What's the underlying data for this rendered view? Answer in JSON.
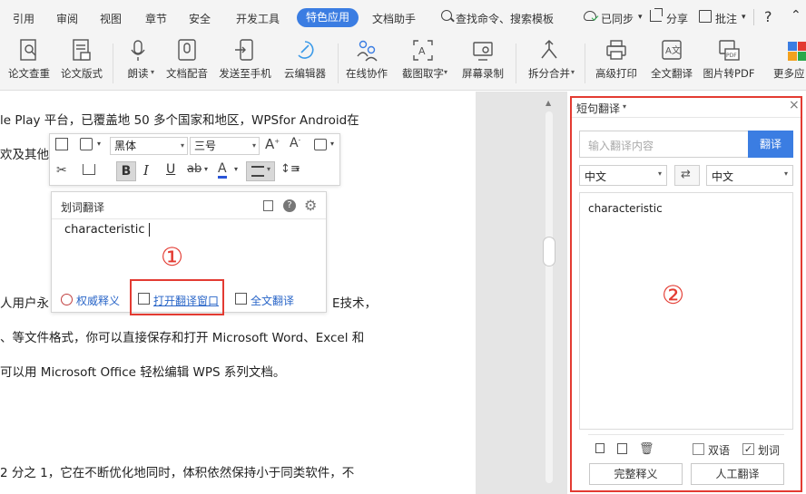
{
  "menu": {
    "items": [
      "引用",
      "审阅",
      "视图",
      "章节",
      "安全",
      "开发工具",
      "特色应用",
      "文档助手"
    ],
    "active": "特色应用",
    "search": "查找命令、搜索模板",
    "sync": "已同步",
    "share": "分享",
    "comment": "批注",
    "help": "?"
  },
  "ribbon": {
    "buttons": [
      "论文查重",
      "论文版式",
      "朗读",
      "文档配音",
      "发送至手机",
      "云编辑器",
      "在线协作",
      "截图取字",
      "屏幕录制",
      "拆分合并",
      "高级打印",
      "全文翻译",
      "图片转PDF",
      "更多应"
    ]
  },
  "document": {
    "lines": [
      "le Play 平台，已覆盖地 50 多个国家和地区，WPSfor Android在",
      "欢及其他素",
      "人用户永",
      "E技术，",
      "、等文件格式，你可以直接保存和打开  Microsoft Word、Excel  和",
      "可以用  Microsoft Office 轻松编辑 WPS 系列文档。",
      "2 分之 1，它在不断优化地同时，体积依然保持小于同类软件，不"
    ]
  },
  "float_toolbar": {
    "font": "黑体",
    "size": "三号",
    "bold": "B",
    "italic": "I",
    "underline": "U"
  },
  "word_popup": {
    "title": "划词翻译",
    "content": "characteristic",
    "marker": "①",
    "links": [
      "权威释义",
      "打开翻译窗口",
      "全文翻译"
    ]
  },
  "pane": {
    "title": "短句翻译",
    "placeholder": "输入翻译内容",
    "translate": "翻译",
    "source_lang": "中文",
    "target_lang": "中文",
    "result": "characteristic",
    "marker": "②",
    "bilingual": "双语",
    "word_select": "划词",
    "full_def": "完整释义",
    "human": "人工翻译"
  },
  "colors": {
    "accent": "#3b7de2",
    "highlight": "#e33b32"
  }
}
